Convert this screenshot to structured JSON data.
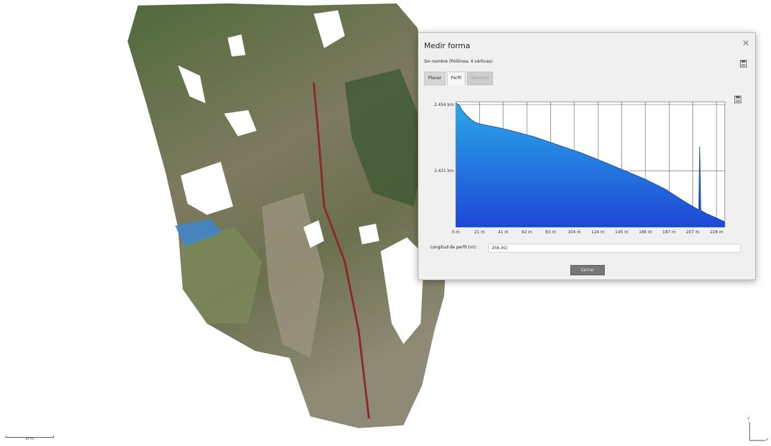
{
  "dialog": {
    "title": "Medir forma",
    "close_glyph": "✕",
    "subtitle": "Sin nombre (Polilínea, 4 vértices)",
    "tabs": [
      {
        "label": "Planar",
        "state": "inactive"
      },
      {
        "label": "Perfil",
        "state": "active"
      },
      {
        "label": "Volumen",
        "state": "disabled"
      }
    ],
    "icons": {
      "subtitle_action": "save-icon",
      "chart_action": "save-icon"
    },
    "profile_length_label": "Longitud de perfil (m):",
    "profile_length_value": "256.91|",
    "close_button_label": "Cerrar"
  },
  "chart_data": {
    "type": "area",
    "title": "",
    "xlabel": "",
    "ylabel": "",
    "y_tick_labels": [
      "2.454 km",
      "2.431 km"
    ],
    "x_tick_labels": [
      "0 m",
      "21 m",
      "41 m",
      "62 m",
      "83 m",
      "104 m",
      "124 m",
      "145 m",
      "166 m",
      "187 m",
      "207 m",
      "228 m"
    ],
    "xlim": [
      0,
      256.91
    ],
    "ylim": [
      2405,
      2457
    ],
    "grid": true,
    "fill_colors": [
      "#2ca8e8",
      "#1d48d6"
    ],
    "x": [
      0,
      3,
      6,
      10,
      15,
      20,
      28,
      40,
      55,
      75,
      95,
      120,
      140,
      160,
      180,
      200,
      220,
      232,
      233,
      234,
      236,
      240,
      248,
      256.91
    ],
    "y": [
      2456.5,
      2455.8,
      2453.5,
      2451.5,
      2449.5,
      2448.2,
      2447.4,
      2446.4,
      2444.8,
      2442.5,
      2439.5,
      2435.8,
      2432.3,
      2428.7,
      2425.1,
      2420.8,
      2415.2,
      2412.2,
      2438.5,
      2412,
      2411.5,
      2410.5,
      2409,
      2407.2
    ]
  },
  "map_overlays": {
    "scale_label": "34 m",
    "axis_labels": [
      "y",
      "x"
    ]
  }
}
